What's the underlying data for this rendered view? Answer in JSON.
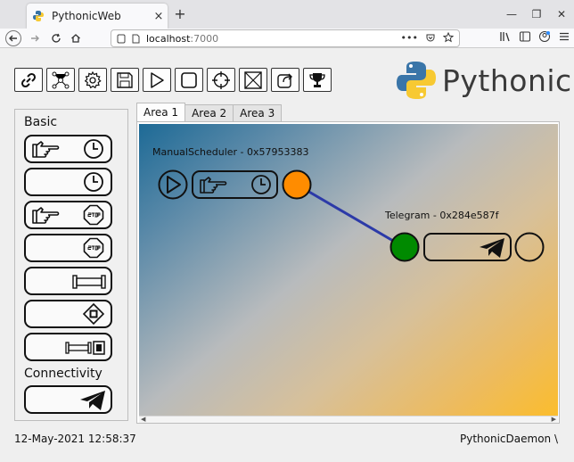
{
  "browser": {
    "tab_title": "PythonicWeb",
    "tab_close": "×",
    "new_tab": "+",
    "url_host": "localhost",
    "url_port": ":7000",
    "url_more": "•••",
    "window_minimize": "—",
    "window_restore": "❐",
    "window_close": "✕"
  },
  "app": {
    "logo_text": "Pythonic",
    "sidebar": {
      "sections": [
        {
          "label": "Basic"
        },
        {
          "label": "Connectivity"
        }
      ]
    },
    "areas": [
      {
        "label": "Area 1"
      },
      {
        "label": "Area 2"
      },
      {
        "label": "Area 3"
      }
    ],
    "nodes": [
      {
        "label": "ManualScheduler - 0x57953383"
      },
      {
        "label": "Telegram - 0x284e587f"
      }
    ],
    "status": {
      "datetime": "12-May-2021 12:58:37",
      "daemon": "PythonicDaemon \\"
    },
    "colors": {
      "output_port": "#ff8c00",
      "input_port": "#008a00",
      "connection": "#2c3aa8"
    }
  }
}
